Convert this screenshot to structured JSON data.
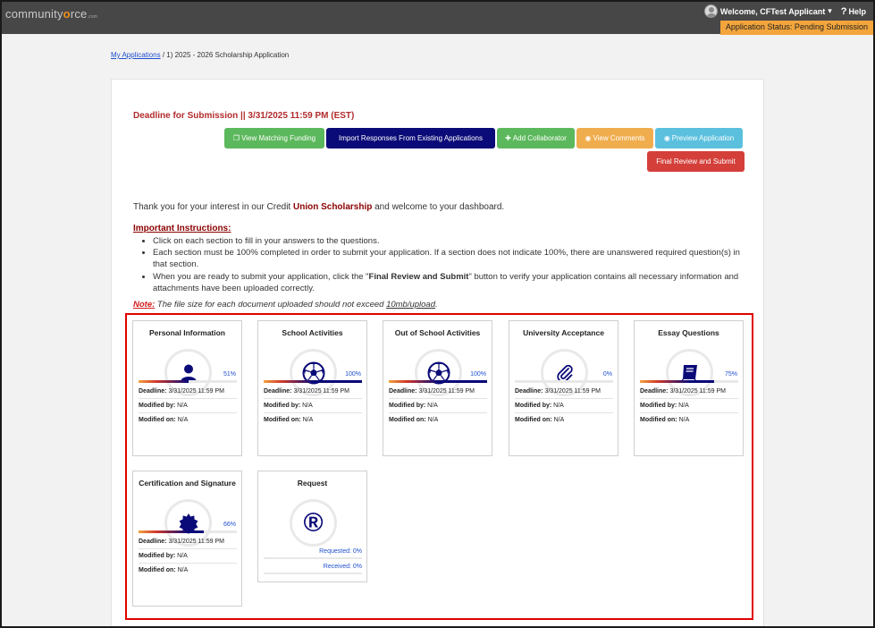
{
  "header": {
    "logo_prefix": "community",
    "logo_o": "o",
    "logo_suffix": "rce",
    "logo_small": ".com",
    "welcome_text": "Welcome, CFTest Applicant",
    "welcome_caret": "▾",
    "help_icon": "?",
    "help_label": "Help",
    "status_text": "Application Status: Pending Submission"
  },
  "breadcrumb": {
    "link": "My Applications",
    "separator": " / ",
    "current": "1) 2025 - 2026 Scholarship Application"
  },
  "deadline": "Deadline for Submission || 3/31/2025 11:59 PM (EST)",
  "buttons": {
    "matching": "View Matching Funding",
    "import": "Import Responses From Existing Applications",
    "collaborator": "Add Collaborator",
    "comments": "View Comments",
    "preview": "Preview Application",
    "final": "Final Review and Submit"
  },
  "intro": {
    "text1": "Thank you for your interest in our Credit ",
    "bold": "Union Scholarship",
    "text2": " and welcome to your dashboard."
  },
  "instructions": {
    "title": "Important Instructions:",
    "item1": "Click on each section to fill in your answers to the questions.",
    "item2": "Each section must be 100% completed in order to submit your application. If a section does not indicate 100%, there are unanswered required question(s) in that section.",
    "item3_pre": "When you are ready to submit your application, click the \"",
    "item3_bold": "Final Review and Submit",
    "item3_post": "\" button to verify your application contains all necessary information and attachments have been uploaded correctly."
  },
  "note": {
    "label": "Note:",
    "text": " The file size for each document uploaded should not exceed ",
    "limit": "10mb/upload",
    "end": "."
  },
  "labels": {
    "deadline": "Deadline:",
    "modified_by": "Modified by:",
    "modified_on": "Modified on:"
  },
  "sections": [
    {
      "title": "Personal Information",
      "icon": "person-icon",
      "percent_label": "51%",
      "percent": 51,
      "deadline": "3/31/2025 11:59 PM",
      "modified_by": "N/A",
      "modified_on": "N/A"
    },
    {
      "title": "School Activities",
      "icon": "soccer-ball-icon",
      "percent_label": "100%",
      "percent": 100,
      "deadline": "3/31/2025 11:59 PM",
      "modified_by": "N/A",
      "modified_on": "N/A"
    },
    {
      "title": "Out of School Activities",
      "icon": "soccer-ball-icon",
      "percent_label": "100%",
      "percent": 100,
      "deadline": "3/31/2025 11:59 PM",
      "modified_by": "N/A",
      "modified_on": "N/A"
    },
    {
      "title": "University Acceptance",
      "icon": "paperclip-icon",
      "percent_label": "0%",
      "percent": 0,
      "deadline": "3/31/2025 11:59 PM",
      "modified_by": "N/A",
      "modified_on": "N/A"
    },
    {
      "title": "Essay Questions",
      "icon": "book-icon",
      "percent_label": "75%",
      "percent": 75,
      "deadline": "3/31/2025 11:59 PM",
      "modified_by": "N/A",
      "modified_on": "N/A"
    },
    {
      "title": "Certification and Signature",
      "icon": "seal-icon",
      "percent_label": "66%",
      "percent": 66,
      "deadline": "3/31/2025 11:59 PM",
      "modified_by": "N/A",
      "modified_on": "N/A"
    }
  ],
  "request": {
    "title": "Request",
    "icon": "registered-icon",
    "icon_glyph": "®",
    "requested": "Requested: 0%",
    "received": "Received: 0%"
  },
  "colors": {
    "navy": "#0a0a78",
    "progress_gradient": [
      "#f2a23c",
      "#d1382b",
      "#0a0a78"
    ],
    "status_bar": "#f3a53c"
  }
}
